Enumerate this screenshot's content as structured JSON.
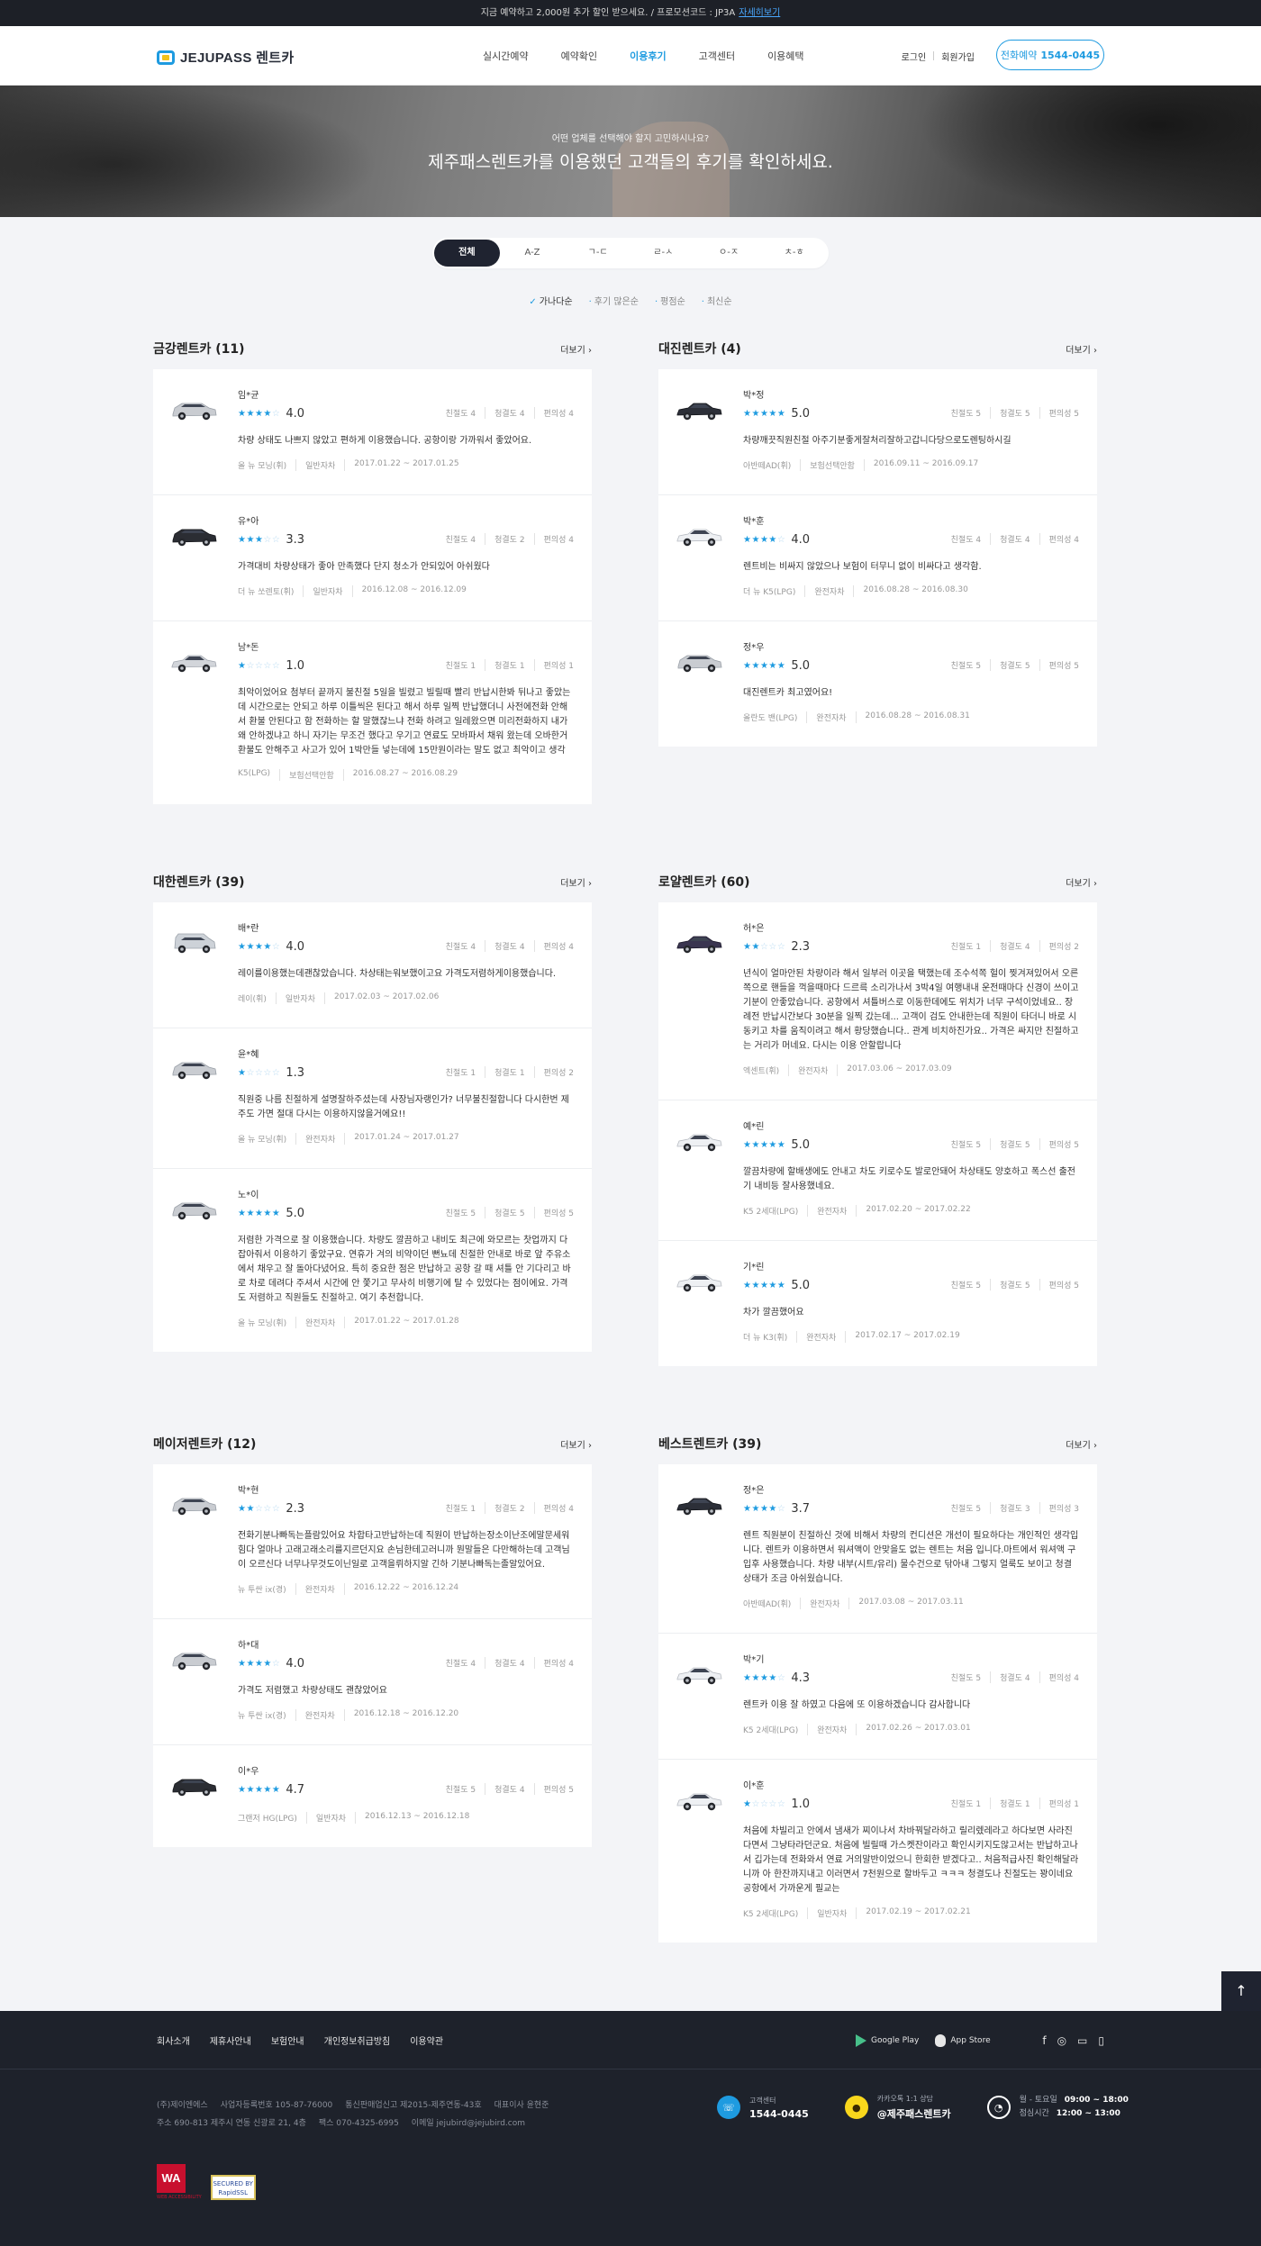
{
  "notice": {
    "text": "지금 예약하고 2,000원 추가 할인 받으세요. / 프로모션코드 : JP3A",
    "link": "자세히보기"
  },
  "header": {
    "logo": "JEJUPASS 렌트카",
    "nav": [
      "실시간예약",
      "예약확인",
      "이용후기",
      "고객센터",
      "이용혜택"
    ],
    "active_nav": "이용후기",
    "login": "로그인",
    "signup": "회원가입",
    "call_label": "전화예약",
    "call_number": "1544-0445"
  },
  "hero": {
    "subtitle": "어떤 업체를 선택해야 할지 고민하시나요?",
    "title": "제주패스렌트카를 이용했던 고객들의 후기를 확인하세요."
  },
  "filters": [
    "전체",
    "A-Z",
    "ㄱ-ㄷ",
    "ㄹ-ㅅ",
    "ㅇ-ㅈ",
    "ㅊ-ㅎ"
  ],
  "sort": [
    "가나다순",
    "후기 많은순",
    "평점순",
    "최신순"
  ],
  "more_label": "더보기",
  "sub_labels": {
    "kind": "친절도",
    "clean": "청결도",
    "convenience": "편의성"
  },
  "companies": [
    {
      "title": "금강렌트카 (11)",
      "reviews": [
        {
          "car": "silver-suv",
          "reviewer": "임*균",
          "stars": 4,
          "score": "4.0",
          "kind": 4,
          "clean": 4,
          "conv": 4,
          "text": "차량 상태도 나쁘지 않았고 편하게 이용했습니다. 공항이랑 가까워서 좋았어요.",
          "model": "올 뉴 모닝(휘)",
          "insurance": "일반자차",
          "period": "2017.01.22 ~ 2017.01.25"
        },
        {
          "car": "black-suv",
          "reviewer": "유*아",
          "stars": 3,
          "score": "3.3",
          "kind": 4,
          "clean": 2,
          "conv": 4,
          "text": "가격대비 차량상태가 좋아 만족했다 단지 청소가 안되있어 아쉬웠다",
          "model": "더 뉴 쏘렌토(휘)",
          "insurance": "일반자차",
          "period": "2016.12.08 ~ 2016.12.09"
        },
        {
          "car": "silver-sedan",
          "reviewer": "남*돈",
          "stars": 1,
          "score": "1.0",
          "kind": 1,
          "clean": 1,
          "conv": 1,
          "text": "최악이었어요 첨부터 끝까지 불친절 5일을 빌렸고 빌릴때 빨리 반납시한봐 뒤나고 좋았는데 시간으로는 안되고 하루 이틀씩은 된다고 해서 하루 일찍 반납했더니 사전에전화 안해서 환불 안된다고 함 전화하는 할 말했잖느냐 전화 하려고 일레왔으면 미리전화하지 내가 왜 안하겠냐고 하니 자기는 무조건 했다고 우기고 연료도 모바파서 채워 왔는데 오바한거 환불도 안해주고 사고가 있어 1박만들 넣는데에 15만원이라는 말도 없고 최악이고 생각",
          "model": "K5(LPG)",
          "insurance": "보험선택안함",
          "period": "2016.08.27 ~ 2016.08.29"
        }
      ]
    },
    {
      "title": "대진렌트카 (4)",
      "reviews": [
        {
          "car": "black-sedan",
          "reviewer": "박*정",
          "stars": 5,
          "score": "5.0",
          "kind": 5,
          "clean": 5,
          "conv": 5,
          "text": "차량깨끗직원친절 아주기분좋게잘처리잘하고갑니다당으로도렌팅하시길",
          "model": "아반떼AD(휘)",
          "insurance": "보험선택안함",
          "period": "2016.09.11 ~ 2016.09.17"
        },
        {
          "car": "white-sedan",
          "reviewer": "박*훈",
          "stars": 4,
          "score": "4.0",
          "kind": 4,
          "clean": 4,
          "conv": 4,
          "text": "렌트비는 비싸지 않았으나 보험이 터무니 없이 비싸다고 생각함.",
          "model": "더 뉴 K5(LPG)",
          "insurance": "완전자차",
          "period": "2016.08.28 ~ 2016.08.30"
        },
        {
          "car": "silver-suv",
          "reviewer": "정*우",
          "stars": 5,
          "score": "5.0",
          "kind": 5,
          "clean": 5,
          "conv": 5,
          "text": "대진렌트카 최고였어요!",
          "model": "올란도 밴(LPG)",
          "insurance": "완전자차",
          "period": "2016.08.28 ~ 2016.08.31"
        }
      ]
    },
    {
      "title": "대한렌트카 (39)",
      "reviews": [
        {
          "car": "silver-van",
          "reviewer": "배*란",
          "stars": 4,
          "score": "4.0",
          "kind": 4,
          "clean": 4,
          "conv": 4,
          "text": "레이를이용했는데괜찮았습니다. 차상태는워보했이고요 가격도저렴하게이용했습니다.",
          "model": "레이(휘)",
          "insurance": "일반자차",
          "period": "2017.02.03 ~ 2017.02.06"
        },
        {
          "car": "silver-suv",
          "reviewer": "윤*혜",
          "stars": 1,
          "score": "1.3",
          "kind": 1,
          "clean": 1,
          "conv": 2,
          "text": "직원중 나름 친절하게 설명잘하주셨는데 사장님자랭인가? 너무불친절합니다 다시한번 제주도 가면 절대 다시는 이용하지않을거에요!!",
          "model": "올 뉴 모닝(휘)",
          "insurance": "완전자차",
          "period": "2017.01.24 ~ 2017.01.27"
        },
        {
          "car": "silver-suv",
          "reviewer": "노*이",
          "stars": 5,
          "score": "5.0",
          "kind": 5,
          "clean": 5,
          "conv": 5,
          "text": "저렴한 가격으로 잘 이용했습니다. 차량도 깔끔하고 내비도 최근에 와모르는 찻업까지 다 잡아줘서 이용하기 좋았구요. 연휴가 겨의 비약이던 뻔뇨데 친절한 안내로 바로 앞 주유소에서 채우고 잘 돌아다녔어요. 특히 중요한 점은 반납하고 공항 갈 때 셔틀 안 기다리고 바로 차로 데려다 주셔서 시간에 안 쫓기고 무사히 비행기에 탈 수 있었다는 점이에요. 가격도 저렴하고 직원들도 친절하고. 여기 추천합니다.",
          "model": "올 뉴 모닝(휘)",
          "insurance": "완전자차",
          "period": "2017.01.22 ~ 2017.01.28"
        }
      ]
    },
    {
      "title": "로얄렌트카 (60)",
      "reviews": [
        {
          "car": "dark-sedan",
          "reviewer": "허*은",
          "stars": 2,
          "score": "2.3",
          "kind": 1,
          "clean": 4,
          "conv": 2,
          "text": "년식이 얼마안된 차량이라 해서 일부러 이곳을 택했는데 조수석쪽 헐이 찢겨져있어서 오른쪽으로 핸들을 꺽을때마다 드르륵 소리가나서 3박4일 여행내내 운전때마다 신경이 쓰이고 기분이 안좋았습니다. 공항에서 셔틀버스로 이동한데에도 위치가 너무 구석이었네요.. 장례전 반납시간보다 30분을 일찍 갔는데... 고객이 검도 안내한는데 직원이 타더니 바로 시동키고 차를 움직이려고 해서 황당했습니다.. 관계 비치하진가요.. 가격은 싸지만 친절하고는 거리가 머네요. 다시는 이용 안할랍니다",
          "model": "엑센트(휘)",
          "insurance": "완전자차",
          "period": "2017.03.06 ~ 2017.03.09"
        },
        {
          "car": "white-sedan",
          "reviewer": "예*린",
          "stars": 5,
          "score": "5.0",
          "kind": 5,
          "clean": 5,
          "conv": 5,
          "text": "깔끔차량에 할배생에도 안내고 차도 키로수도 발로안돼어 차상태도 양호하고 폭스선 출전기 내비등 잘사용했네요.",
          "model": "K5 2세대(LPG)",
          "insurance": "완전자차",
          "period": "2017.02.20 ~ 2017.02.22"
        },
        {
          "car": "white-sedan",
          "reviewer": "기*린",
          "stars": 5,
          "score": "5.0",
          "kind": 5,
          "clean": 5,
          "conv": 5,
          "text": "차가 깔끔했어요",
          "model": "더 뉴 K3(휘)",
          "insurance": "완전자차",
          "period": "2017.02.17 ~ 2017.02.19"
        }
      ]
    },
    {
      "title": "메이저렌트카 (12)",
      "reviews": [
        {
          "car": "silver-suv",
          "reviewer": "박*현",
          "stars": 2,
          "score": "2.3",
          "kind": 1,
          "clean": 2,
          "conv": 4,
          "text": "전화기분나빠독는플람있어요 차합타고반납하는데 직원이 반납하는장소이난조에말문세워힘다 얼마나 고래고래소리를지르던지요 손님한테고러니까 뭔말들은 다만해하는데 고객님이 오르신다 너무나무것도이닌일로 고객을뤼하지알 긴하 기분나빠독는졸알있어요.",
          "model": "뉴 투싼 ix(경)",
          "insurance": "완전자차",
          "period": "2016.12.22 ~ 2016.12.24"
        },
        {
          "car": "silver-suv",
          "reviewer": "하*대",
          "stars": 4,
          "score": "4.0",
          "kind": 4,
          "clean": 4,
          "conv": 4,
          "text": "가격도 저렴했고 차량상태도 괜찮았어요",
          "model": "뉴 투싼 ix(경)",
          "insurance": "완전자차",
          "period": "2016.12.18 ~ 2016.12.20"
        },
        {
          "car": "black-suv",
          "reviewer": "이*우",
          "stars": 5,
          "score": "4.7",
          "kind": 5,
          "clean": 4,
          "conv": 5,
          "text": "",
          "model": "그랜저 HG(LPG)",
          "insurance": "일반자차",
          "period": "2016.12.13 ~ 2016.12.18"
        }
      ]
    },
    {
      "title": "베스트렌트카 (39)",
      "reviews": [
        {
          "car": "black-sedan",
          "reviewer": "정*은",
          "stars": 4,
          "score": "3.7",
          "kind": 5,
          "clean": 3,
          "conv": 3,
          "text": "렌트 직원분이 친절하신 것에 비해서 차량의 컨디션은 개선이 필요하다는 개인적인 생각입니다. 렌트카 이용하면서 워셔액이 안맞을도 없는 렌트는 처음 입니다.마트에서 워셔액 구입후 사용했습니다. 차량 내부(시트/유리) 물수건으로 닦아내 그렇지 얼룩도 보이고 청결 상태가 조금 아쉬웠습니다.",
          "model": "아반떼AD(휘)",
          "insurance": "완전자차",
          "period": "2017.03.08 ~ 2017.03.11"
        },
        {
          "car": "white-sedan",
          "reviewer": "박*기",
          "stars": 4,
          "score": "4.3",
          "kind": 5,
          "clean": 4,
          "conv": 4,
          "text": "렌트카 이용 잘 하였고 다음에 또 이용하겠습니다 감사합니다",
          "model": "K5 2세대(LPG)",
          "insurance": "완전자차",
          "period": "2017.02.26 ~ 2017.03.01"
        },
        {
          "car": "white-sedan",
          "reviewer": "이*훈",
          "stars": 1,
          "score": "1.0",
          "kind": 1,
          "clean": 1,
          "conv": 1,
          "text": "처음에 차빌리고 안에서 냄새가 찌이나서 차바꿔달라하고 릴리렜레라고 하다보면 사라진다면서 그냥타라던군요. 처음에 빌릴때 가스켓잔이라고 확인시키지도않고서는 반납하고나서 깁가는데 전화와서 연료 거의말반이었으니 한회한 받겠다고.. 처음적급사진 확인해달라니까 아 한잔까지내고 이러면서 7천원으로 할바두고 ㅋㅋㅋ 청결도나 친절도는 꽝이네요 공항에서 가까운게 필교는",
          "model": "K5 2세대(LPG)",
          "insurance": "일반자차",
          "period": "2017.02.19 ~ 2017.02.21"
        }
      ]
    }
  ],
  "footer": {
    "links": [
      "회사소개",
      "제휴사안내",
      "보험안내",
      "개인정보취급방침",
      "이용약관"
    ],
    "google_play": "Google Play",
    "app_store": "App Store",
    "company_line1": [
      "(주)제이엔에스",
      "사업자등록번호 105-87-76000",
      "통신판매업신고 제2015-제주연동-43호",
      "대표이사 윤현준"
    ],
    "company_line2": [
      "주소 690-813 제주시 연동 신광로 21, 4층",
      "팩스 070-4325-6995",
      "이메일 jejubird@jejubird.com"
    ],
    "cs_label": "고객센터",
    "cs_number": "1544-0445",
    "kakao_label": "카카오톡 1:1 상담",
    "kakao_id": "@제주패스렌트카",
    "hours_weekday_label": "월 - 토요일",
    "hours_weekday": "09:00 ~ 18:00",
    "hours_lunch_label": "점심시간",
    "hours_lunch": "12:00 ~ 13:00",
    "badge_wa": "WA",
    "badge_wa_sub": "WEB ACCESSIBILITY",
    "badge_ssl": "SECURED BY RapidSSL"
  },
  "colors": {
    "accent": "#1e9be0",
    "dark": "#1f2330",
    "kakao": "#f9d71c"
  }
}
